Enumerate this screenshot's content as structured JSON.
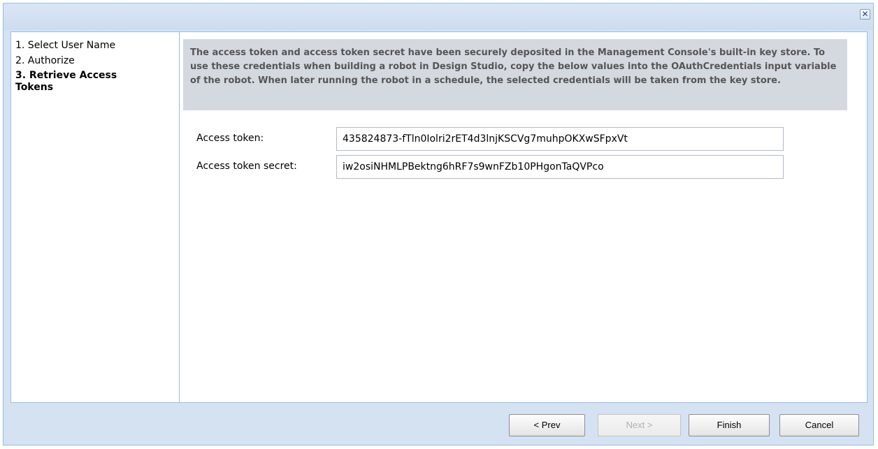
{
  "window": {
    "close_symbol": "✕"
  },
  "steps": [
    {
      "label": "1. Select User Name",
      "active": false
    },
    {
      "label": "2. Authorize",
      "active": false
    },
    {
      "label": "3. Retrieve Access Tokens",
      "active": true
    }
  ],
  "info": {
    "text": "The access token and access token secret have been securely deposited in the Management Console's built-in key store. To use these credentials when building a robot in Design Studio, copy the below values into the OAuthCredentials input variable of the robot. When later running the robot in a schedule, the selected credentials will be taken from the key store."
  },
  "fields": {
    "access_token": {
      "label": "Access token:",
      "value": "435824873-fTln0Iolri2rET4d3lnjKSCVg7muhpOKXwSFpxVt"
    },
    "access_token_secret": {
      "label": "Access token secret:",
      "value": "iw2osiNHMLPBektng6hRF7s9wnFZb10PHgonTaQVPco"
    }
  },
  "buttons": {
    "prev": "< Prev",
    "next": "Next >",
    "finish": "Finish",
    "cancel": "Cancel"
  },
  "icons": {
    "close": "close-icon"
  }
}
